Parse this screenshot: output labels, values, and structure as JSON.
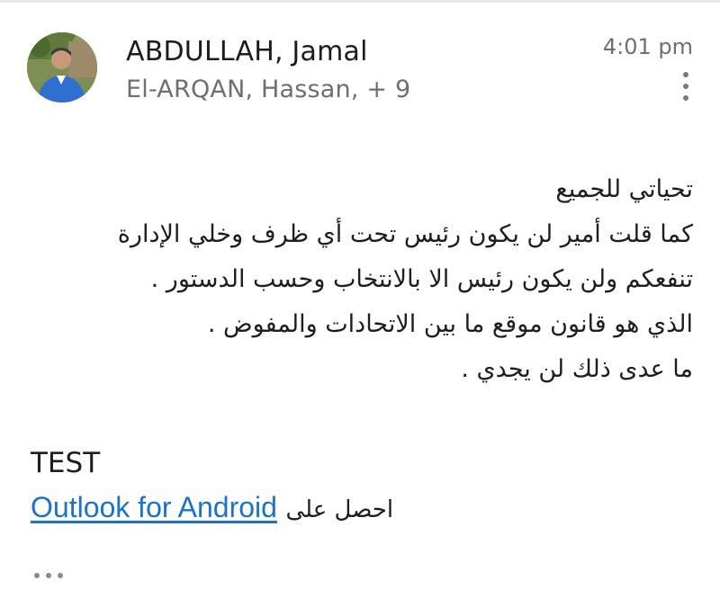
{
  "header": {
    "sender_name": "ABDULLAH, Jamal",
    "recipients": "El-ARQAN, Hassan, + 9",
    "time": "4:01 pm",
    "avatar_icon": "person-photo-icon",
    "more_icon": "more-vertical-icon"
  },
  "message": {
    "lines": [
      "تحياتي للجميع",
      "كما قلت أمير لن يكون رئيس تحت أي ظرف  وخلي الإدارة",
      "تنفعكم ولن يكون رئيس الا بالانتخاب وحسب الدستور .",
      "الذي هو قانون موقع ما بين الاتحادات والمفوض .",
      "ما عدى ذلك لن يجدي ."
    ],
    "test_text": "TEST",
    "signature_prefix": "احصل على",
    "signature_link": "Outlook for Android",
    "expand_icon": "more-horizontal-icon"
  },
  "colors": {
    "link": "#1a73c8",
    "secondary_text": "#6f6f6f",
    "primary_text": "#1e1e1e"
  }
}
